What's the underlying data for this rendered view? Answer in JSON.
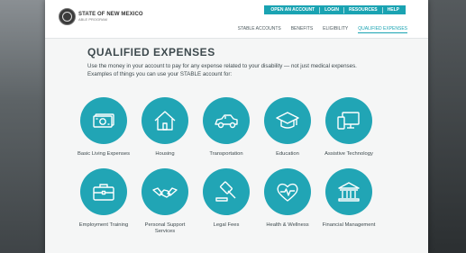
{
  "header": {
    "logo_title": "STATE OF NEW MEXICO",
    "logo_subtitle": "ABLE PROGRAM",
    "utility_nav": [
      "OPEN AN ACCOUNT",
      "LOGIN",
      "RESOURCES",
      "HELP"
    ],
    "main_nav": [
      "STABLE ACCOUNTS",
      "BENEFITS",
      "ELIGIBILITY",
      "QUALIFIED EXPENSES"
    ],
    "active_nav": "QUALIFIED EXPENSES"
  },
  "page": {
    "title": "QUALIFIED EXPENSES",
    "intro": "Use the money in your account to pay for any expense related to your disability — not just medical expenses. Examples of things you can use your STABLE account for:"
  },
  "expenses": [
    {
      "label": "Basic Living Expenses",
      "icon": "money-icon"
    },
    {
      "label": "Housing",
      "icon": "house-icon"
    },
    {
      "label": "Transportation",
      "icon": "car-icon"
    },
    {
      "label": "Education",
      "icon": "graduation-cap-icon"
    },
    {
      "label": "Assistive Technology",
      "icon": "devices-icon"
    },
    {
      "label": "Employment Training",
      "icon": "briefcase-icon"
    },
    {
      "label": "Personal Support Services",
      "icon": "handshake-icon"
    },
    {
      "label": "Legal Fees",
      "icon": "gavel-icon"
    },
    {
      "label": "Health & Wellness",
      "icon": "heart-pulse-icon"
    },
    {
      "label": "Financial Management",
      "icon": "bank-icon"
    }
  ],
  "colors": {
    "accent": "#21a5b5",
    "nav_bar": "#1aa3b2",
    "text": "#3e4a4e"
  }
}
